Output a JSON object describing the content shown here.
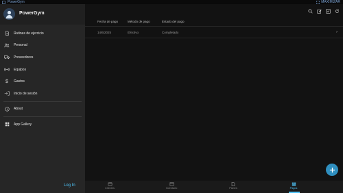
{
  "window": {
    "title": "PowerGym",
    "maximize_label": "MAXIMIZAR"
  },
  "drawer": {
    "app_name": "PowerGym",
    "items": [
      {
        "label": "Rutinas de ejercicio",
        "icon": "document-icon"
      },
      {
        "label": "Personal",
        "icon": "people-icon"
      },
      {
        "label": "Proveedores",
        "icon": "truck-icon"
      },
      {
        "label": "Equipos",
        "icon": "dumbbell-icon"
      },
      {
        "label": "Gastos",
        "icon": "dollar-icon"
      },
      {
        "label": "Inicio de sesión",
        "icon": "login-icon"
      }
    ],
    "secondary_items": [
      {
        "label": "About",
        "icon": "info-icon"
      },
      {
        "label": "App Gallery",
        "icon": "grid-icon"
      }
    ],
    "login_label": "Log In"
  },
  "toolbar": {
    "icons": [
      "search-icon",
      "edit-icon",
      "checkbox-icon",
      "refresh-icon"
    ]
  },
  "table": {
    "headers": [
      "Fecha de pago",
      "Método de pago",
      "Estado del pago"
    ],
    "rows": [
      {
        "fecha": "14/6/2025",
        "metodo": "Efectivo",
        "estado": "Completado"
      }
    ]
  },
  "bottom_nav": {
    "items": [
      {
        "label": "Clientes",
        "icon": "database-icon"
      },
      {
        "label": "Inventario",
        "icon": "calendar-icon"
      },
      {
        "label": "Planes",
        "icon": "document-icon"
      },
      {
        "label": "Pagos",
        "icon": "payments-icon"
      }
    ],
    "active": "Pagos"
  },
  "colors": {
    "accent": "#4fc3f7",
    "fab": "#2f8fbf",
    "drawer_bg": "#262626",
    "main_bg": "#121212"
  }
}
